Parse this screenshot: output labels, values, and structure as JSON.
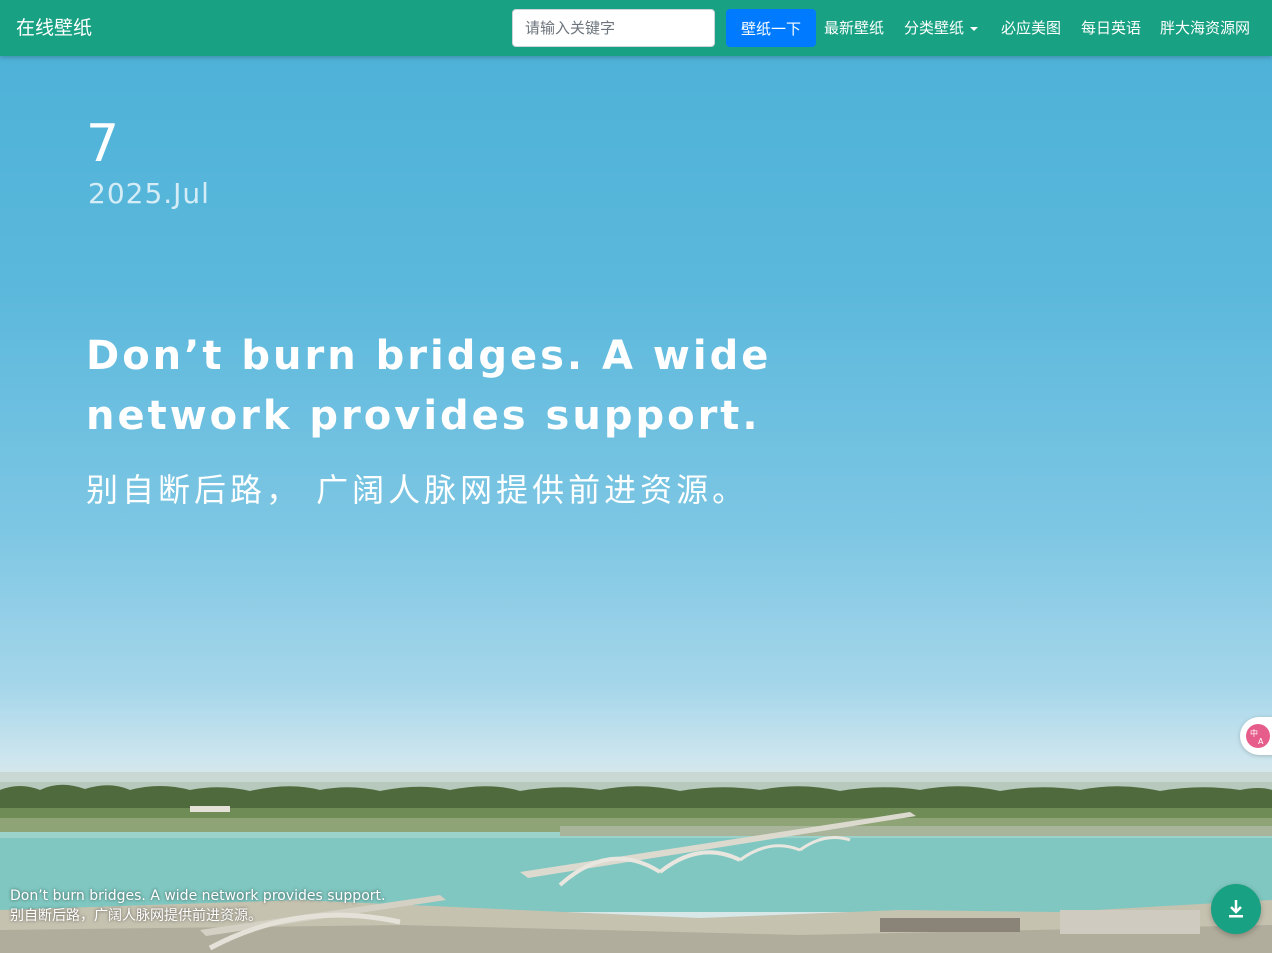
{
  "navbar": {
    "brand": "在线壁纸",
    "search_placeholder": "请输入关键字",
    "search_button": "壁纸一下",
    "links": {
      "latest": "最新壁纸",
      "category": "分类壁纸",
      "bing": "必应美图",
      "english": "每日英语",
      "resources": "胖大海资源网"
    }
  },
  "hero": {
    "day": "7",
    "year_month": "2025.Jul",
    "quote_en": "Don’t burn bridges. A wide network provides support.",
    "quote_zh": "别自断后路， 广阔人脉网提供前进资源。"
  },
  "caption": {
    "line_en": "Don’t burn bridges. A wide network provides support.",
    "line_zh": "别自断后路，广阔人脉网提供前进资源。"
  },
  "icons": {
    "translate": "translate-icon",
    "download": "download-icon",
    "caret": "caret-down-icon"
  },
  "colors": {
    "navbar": "#18a182",
    "search_button": "#007bff",
    "download_button": "#18a182",
    "sky": "#4bb0d6",
    "water": "#7fc7c0"
  }
}
